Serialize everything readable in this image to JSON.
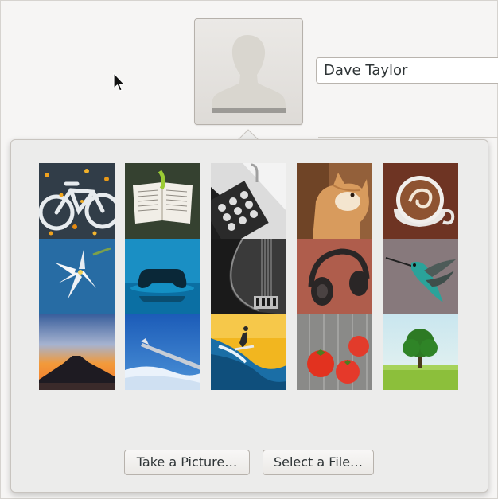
{
  "user": {
    "full_name": "Dave Taylor"
  },
  "avatar_popover": {
    "tiles": [
      {
        "name": "bicycle"
      },
      {
        "name": "book"
      },
      {
        "name": "calculator"
      },
      {
        "name": "cat"
      },
      {
        "name": "coffee"
      },
      {
        "name": "flower"
      },
      {
        "name": "gamepad"
      },
      {
        "name": "guitar"
      },
      {
        "name": "headphones"
      },
      {
        "name": "hummingbird"
      },
      {
        "name": "mountain"
      },
      {
        "name": "plane"
      },
      {
        "name": "surfer"
      },
      {
        "name": "tomatoes"
      },
      {
        "name": "tree"
      }
    ],
    "take_picture_label": "Take a Picture…",
    "select_file_label": "Select a File…"
  }
}
